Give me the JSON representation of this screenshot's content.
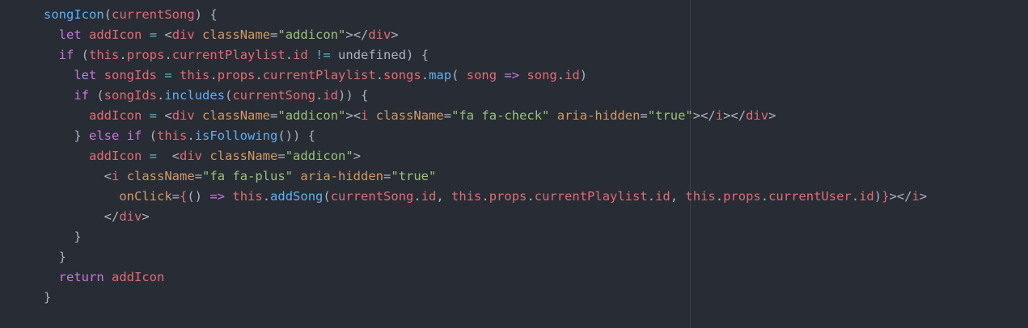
{
  "colors": {
    "background": "#282c34",
    "keyword": "#c678dd",
    "function": "#61afef",
    "variable": "#e06c75",
    "attribute": "#d19a66",
    "string": "#98c379",
    "operator": "#56b6c2",
    "plain": "#abb2bf"
  },
  "code": {
    "lines": [
      [
        {
          "t": "songIcon",
          "k": "function"
        },
        {
          "t": "(",
          "k": "plain"
        },
        {
          "t": "currentSong",
          "k": "variable"
        },
        {
          "t": ") {",
          "k": "plain"
        }
      ],
      [
        {
          "t": "  ",
          "k": "plain"
        },
        {
          "t": "let",
          "k": "keyword"
        },
        {
          "t": " ",
          "k": "plain"
        },
        {
          "t": "addIcon",
          "k": "variable"
        },
        {
          "t": " ",
          "k": "plain"
        },
        {
          "t": "=",
          "k": "operator"
        },
        {
          "t": " <",
          "k": "plain"
        },
        {
          "t": "div",
          "k": "tag"
        },
        {
          "t": " ",
          "k": "plain"
        },
        {
          "t": "className",
          "k": "attr"
        },
        {
          "t": "=",
          "k": "plain"
        },
        {
          "t": "\"addicon\"",
          "k": "string"
        },
        {
          "t": "></",
          "k": "plain"
        },
        {
          "t": "div",
          "k": "tag"
        },
        {
          "t": ">",
          "k": "plain"
        }
      ],
      [
        {
          "t": "  ",
          "k": "plain"
        },
        {
          "t": "if",
          "k": "keyword"
        },
        {
          "t": " (",
          "k": "plain"
        },
        {
          "t": "this",
          "k": "this"
        },
        {
          "t": ".",
          "k": "plain"
        },
        {
          "t": "props",
          "k": "variable"
        },
        {
          "t": ".",
          "k": "plain"
        },
        {
          "t": "currentPlaylist",
          "k": "variable"
        },
        {
          "t": ".",
          "k": "plain"
        },
        {
          "t": "id",
          "k": "variable"
        },
        {
          "t": " ",
          "k": "plain"
        },
        {
          "t": "!=",
          "k": "operator"
        },
        {
          "t": " undefined) {",
          "k": "plain"
        }
      ],
      [
        {
          "t": "    ",
          "k": "plain"
        },
        {
          "t": "let",
          "k": "keyword"
        },
        {
          "t": " ",
          "k": "plain"
        },
        {
          "t": "songIds",
          "k": "variable"
        },
        {
          "t": " ",
          "k": "plain"
        },
        {
          "t": "=",
          "k": "operator"
        },
        {
          "t": " ",
          "k": "plain"
        },
        {
          "t": "this",
          "k": "this"
        },
        {
          "t": ".",
          "k": "plain"
        },
        {
          "t": "props",
          "k": "variable"
        },
        {
          "t": ".",
          "k": "plain"
        },
        {
          "t": "currentPlaylist",
          "k": "variable"
        },
        {
          "t": ".",
          "k": "plain"
        },
        {
          "t": "songs",
          "k": "variable"
        },
        {
          "t": ".",
          "k": "plain"
        },
        {
          "t": "map",
          "k": "function"
        },
        {
          "t": "( ",
          "k": "plain"
        },
        {
          "t": "song",
          "k": "variable"
        },
        {
          "t": " ",
          "k": "plain"
        },
        {
          "t": "=>",
          "k": "keyword"
        },
        {
          "t": " ",
          "k": "plain"
        },
        {
          "t": "song",
          "k": "variable"
        },
        {
          "t": ".",
          "k": "plain"
        },
        {
          "t": "id",
          "k": "variable"
        },
        {
          "t": ")",
          "k": "plain"
        }
      ],
      [
        {
          "t": "    ",
          "k": "plain"
        },
        {
          "t": "if",
          "k": "keyword"
        },
        {
          "t": " (",
          "k": "plain"
        },
        {
          "t": "songIds",
          "k": "variable"
        },
        {
          "t": ".",
          "k": "plain"
        },
        {
          "t": "includes",
          "k": "function"
        },
        {
          "t": "(",
          "k": "plain"
        },
        {
          "t": "currentSong",
          "k": "variable"
        },
        {
          "t": ".",
          "k": "plain"
        },
        {
          "t": "id",
          "k": "variable"
        },
        {
          "t": ")) {",
          "k": "plain"
        }
      ],
      [
        {
          "t": "      ",
          "k": "plain"
        },
        {
          "t": "addIcon",
          "k": "variable"
        },
        {
          "t": " ",
          "k": "plain"
        },
        {
          "t": "=",
          "k": "operator"
        },
        {
          "t": " <",
          "k": "plain"
        },
        {
          "t": "div",
          "k": "tag"
        },
        {
          "t": " ",
          "k": "plain"
        },
        {
          "t": "className",
          "k": "attr"
        },
        {
          "t": "=",
          "k": "plain"
        },
        {
          "t": "\"addicon\"",
          "k": "string"
        },
        {
          "t": "><",
          "k": "plain"
        },
        {
          "t": "i",
          "k": "tag"
        },
        {
          "t": " ",
          "k": "plain"
        },
        {
          "t": "className",
          "k": "attr"
        },
        {
          "t": "=",
          "k": "plain"
        },
        {
          "t": "\"fa fa-check\"",
          "k": "string"
        },
        {
          "t": " ",
          "k": "plain"
        },
        {
          "t": "aria-hidden",
          "k": "attr"
        },
        {
          "t": "=",
          "k": "plain"
        },
        {
          "t": "\"true\"",
          "k": "string"
        },
        {
          "t": "></",
          "k": "plain"
        },
        {
          "t": "i",
          "k": "tag"
        },
        {
          "t": "></",
          "k": "plain"
        },
        {
          "t": "div",
          "k": "tag"
        },
        {
          "t": ">",
          "k": "plain"
        }
      ],
      [
        {
          "t": "    } ",
          "k": "plain"
        },
        {
          "t": "else",
          "k": "keyword"
        },
        {
          "t": " ",
          "k": "plain"
        },
        {
          "t": "if",
          "k": "keyword"
        },
        {
          "t": " (",
          "k": "plain"
        },
        {
          "t": "this",
          "k": "this"
        },
        {
          "t": ".",
          "k": "plain"
        },
        {
          "t": "isFollowing",
          "k": "function"
        },
        {
          "t": "()) {",
          "k": "plain"
        }
      ],
      [
        {
          "t": "      ",
          "k": "plain"
        },
        {
          "t": "addIcon",
          "k": "variable"
        },
        {
          "t": " ",
          "k": "plain"
        },
        {
          "t": "=",
          "k": "operator"
        },
        {
          "t": "  <",
          "k": "plain"
        },
        {
          "t": "div",
          "k": "tag"
        },
        {
          "t": " ",
          "k": "plain"
        },
        {
          "t": "className",
          "k": "attr"
        },
        {
          "t": "=",
          "k": "plain"
        },
        {
          "t": "\"addicon\"",
          "k": "string"
        },
        {
          "t": ">",
          "k": "plain"
        }
      ],
      [
        {
          "t": "        <",
          "k": "plain"
        },
        {
          "t": "i",
          "k": "tag"
        },
        {
          "t": " ",
          "k": "plain"
        },
        {
          "t": "className",
          "k": "attr"
        },
        {
          "t": "=",
          "k": "plain"
        },
        {
          "t": "\"fa fa-plus\"",
          "k": "string"
        },
        {
          "t": " ",
          "k": "plain"
        },
        {
          "t": "aria-hidden",
          "k": "attr"
        },
        {
          "t": "=",
          "k": "plain"
        },
        {
          "t": "\"true\"",
          "k": "string"
        }
      ],
      [
        {
          "t": "          ",
          "k": "plain"
        },
        {
          "t": "onClick",
          "k": "attr"
        },
        {
          "t": "=",
          "k": "plain"
        },
        {
          "t": "{",
          "k": "brace"
        },
        {
          "t": "() ",
          "k": "plain"
        },
        {
          "t": "=>",
          "k": "keyword"
        },
        {
          "t": " ",
          "k": "plain"
        },
        {
          "t": "this",
          "k": "this"
        },
        {
          "t": ".",
          "k": "plain"
        },
        {
          "t": "addSong",
          "k": "function"
        },
        {
          "t": "(",
          "k": "plain"
        },
        {
          "t": "currentSong",
          "k": "variable"
        },
        {
          "t": ".",
          "k": "plain"
        },
        {
          "t": "id",
          "k": "variable"
        },
        {
          "t": ", ",
          "k": "plain"
        },
        {
          "t": "this",
          "k": "this"
        },
        {
          "t": ".",
          "k": "plain"
        },
        {
          "t": "props",
          "k": "variable"
        },
        {
          "t": ".",
          "k": "plain"
        },
        {
          "t": "currentPlaylist",
          "k": "variable"
        },
        {
          "t": ".",
          "k": "plain"
        },
        {
          "t": "id",
          "k": "variable"
        },
        {
          "t": ", ",
          "k": "plain"
        },
        {
          "t": "this",
          "k": "this"
        },
        {
          "t": ".",
          "k": "plain"
        },
        {
          "t": "props",
          "k": "variable"
        },
        {
          "t": ".",
          "k": "plain"
        },
        {
          "t": "currentUser",
          "k": "variable"
        },
        {
          "t": ".",
          "k": "plain"
        },
        {
          "t": "id",
          "k": "variable"
        },
        {
          "t": ")",
          "k": "plain"
        },
        {
          "t": "}",
          "k": "brace"
        },
        {
          "t": "></",
          "k": "plain"
        },
        {
          "t": "i",
          "k": "tag"
        },
        {
          "t": ">",
          "k": "plain"
        }
      ],
      [
        {
          "t": "        </",
          "k": "plain"
        },
        {
          "t": "div",
          "k": "tag"
        },
        {
          "t": ">",
          "k": "plain"
        }
      ],
      [
        {
          "t": "    }",
          "k": "plain"
        }
      ],
      [
        {
          "t": "  }",
          "k": "plain"
        }
      ],
      [
        {
          "t": "  ",
          "k": "plain"
        },
        {
          "t": "return",
          "k": "keyword"
        },
        {
          "t": " ",
          "k": "plain"
        },
        {
          "t": "addIcon",
          "k": "variable"
        }
      ],
      [
        {
          "t": "}",
          "k": "plain"
        }
      ]
    ]
  }
}
